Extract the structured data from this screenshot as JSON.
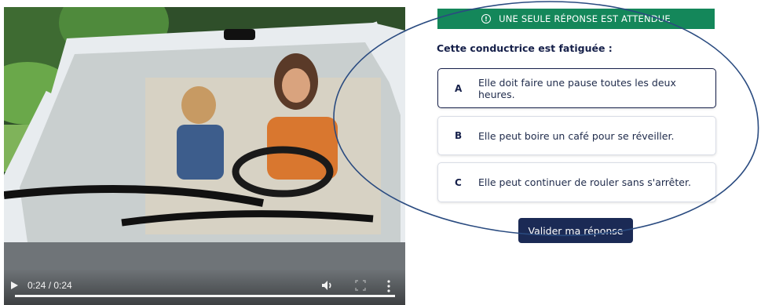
{
  "video": {
    "time_display": "0:24 / 0:24",
    "progress": 1.0
  },
  "quiz": {
    "banner_icon": "info-icon",
    "banner": "UNE SEULE RÉPONSE EST ATTENDUE",
    "question": "Cette conductrice est fatiguée :",
    "options": [
      {
        "letter": "A",
        "text": "Elle doit faire une pause toutes les deux heures.",
        "selected": true
      },
      {
        "letter": "B",
        "text": "Elle peut boire un café pour se réveiller.",
        "selected": false
      },
      {
        "letter": "C",
        "text": "Elle peut continuer de rouler sans s'arrêter.",
        "selected": false
      }
    ],
    "submit_label": "Valider ma réponse"
  },
  "colors": {
    "banner_green": "#14875a",
    "navy": "#1b2a55",
    "annotation_blue": "#2a4b80"
  }
}
